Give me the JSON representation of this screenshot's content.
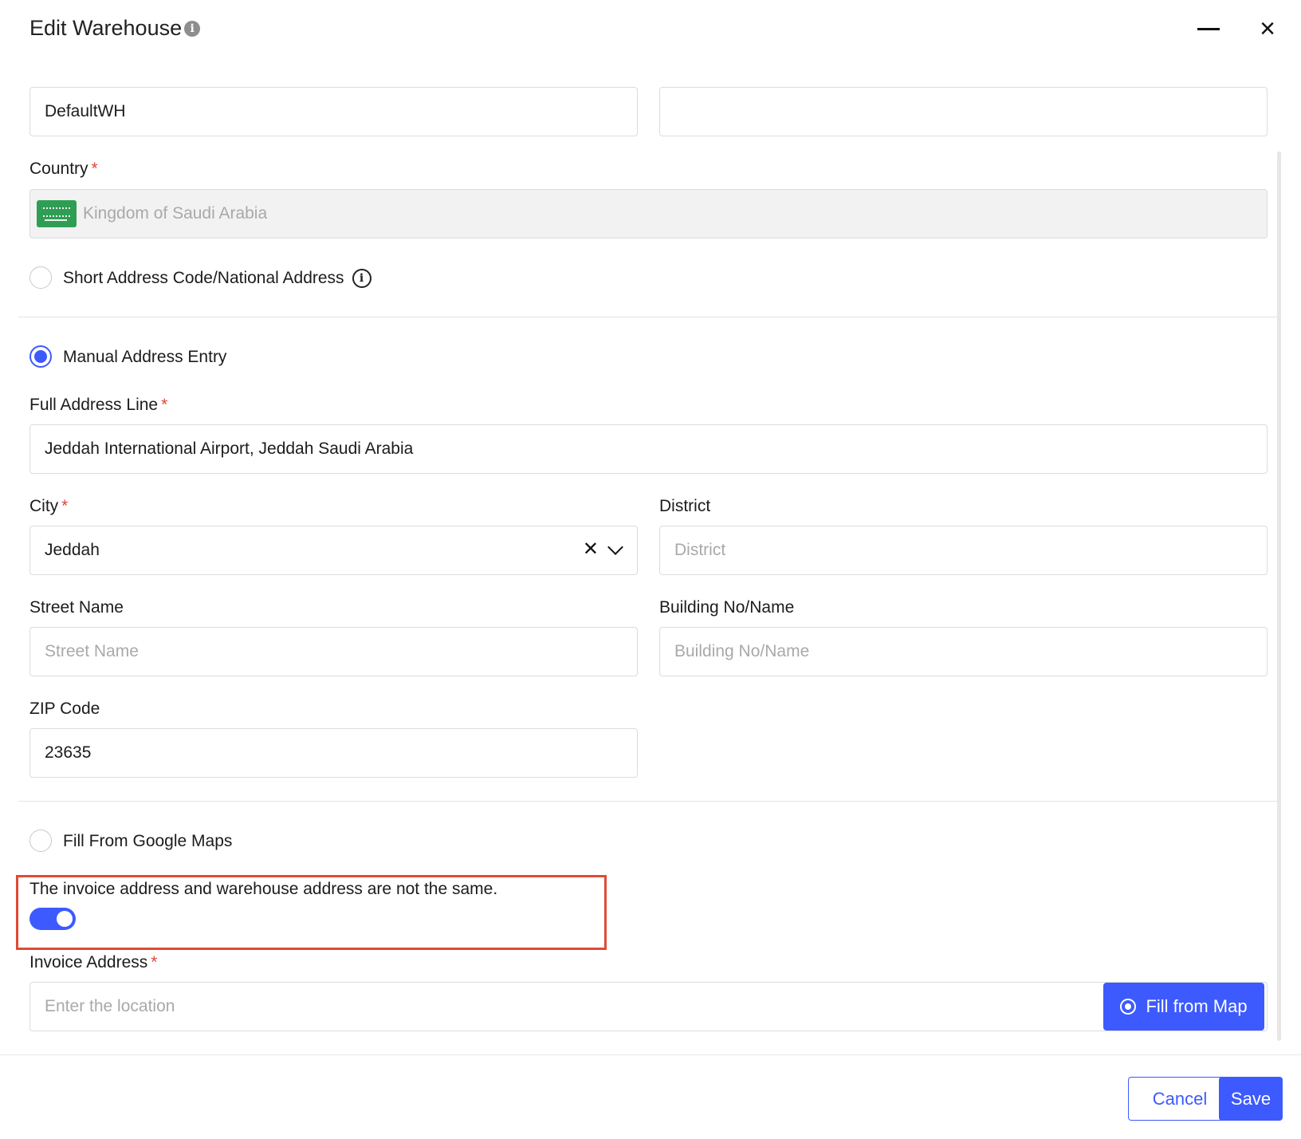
{
  "header": {
    "title": "Edit Warehouse"
  },
  "top_fields": {
    "name_value": "DefaultWH",
    "second_value": ""
  },
  "country": {
    "label": "Country",
    "value": "Kingdom of Saudi Arabia"
  },
  "address_modes": {
    "short_code_label": "Short Address Code/National Address",
    "manual_label": "Manual Address Entry",
    "google_label": "Fill From Google Maps"
  },
  "full_address": {
    "label": "Full Address Line",
    "value": "Jeddah International Airport, Jeddah Saudi Arabia"
  },
  "city": {
    "label": "City",
    "value": "Jeddah"
  },
  "district": {
    "label": "District",
    "placeholder": "District"
  },
  "street": {
    "label": "Street Name",
    "placeholder": "Street Name"
  },
  "building": {
    "label": "Building No/Name",
    "placeholder": "Building No/Name"
  },
  "zip": {
    "label": "ZIP Code",
    "value": "23635"
  },
  "invoice_toggle": {
    "label": "The invoice address and warehouse address are not the same.",
    "on": true
  },
  "invoice_address": {
    "label": "Invoice Address",
    "placeholder": "Enter the location",
    "button": "Fill from Map"
  },
  "footer": {
    "cancel": "Cancel",
    "save": "Save"
  },
  "colors": {
    "accent": "#3d5afe",
    "required": "#e0463a",
    "highlight": "#e04a34"
  }
}
